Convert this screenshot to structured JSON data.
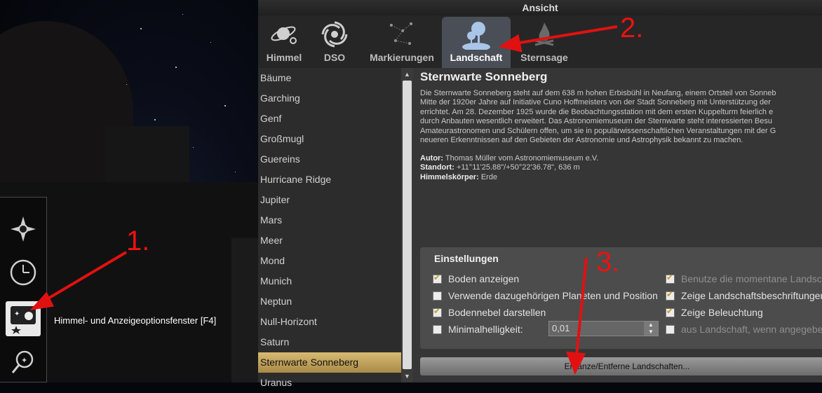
{
  "window_title": "Ansicht",
  "tabs": [
    {
      "label": "Himmel",
      "icon": "planet-icon"
    },
    {
      "label": "DSO",
      "icon": "galaxy-icon"
    },
    {
      "label": "Markierungen",
      "icon": "constellation-icon"
    },
    {
      "label": "Landschaft",
      "icon": "landscape-tree-icon"
    },
    {
      "label": "Sternsage",
      "icon": "campfire-icon"
    }
  ],
  "active_tab": "Landschaft",
  "landscapes": [
    "Bäume",
    "Garching",
    "Genf",
    "Großmugl",
    "Guereins",
    "Hurricane Ridge",
    "Jupiter",
    "Mars",
    "Meer",
    "Mond",
    "Munich",
    "Neptun",
    "Null-Horizont",
    "Saturn",
    "Sternwarte Sonneberg",
    "Uranus"
  ],
  "selected_landscape": "Sternwarte Sonneberg",
  "description": {
    "title": "Sternwarte Sonneberg",
    "body_lines": [
      "Die Sternwarte Sonneberg steht auf dem 638 m hohen Erbisbühl in Neufang, einem Ortsteil von Sonneb",
      "Mitte der 1920er Jahre auf Initiative Cuno Hoffmeisters von der Stadt Sonneberg mit Unterstützung der",
      "errichtet. Am 28. Dezember 1925 wurde die Beobachtungsstation mit dem ersten Kuppelturm feierlich e",
      "durch Anbauten wesentlich erweitert. Das Astronomiemuseum der Sternwarte steht interessierten Besu",
      "Amateurastronomen und Schülern offen, um sie in populärwissenschaftlichen Veranstaltungen mit der G",
      "neueren Erkenntnissen auf den Gebieten der Astronomie und Astrophysik bekannt zu machen."
    ],
    "author_label": "Autor:",
    "author": "Thomas Müller vom Astronomiemuseum e.V.",
    "location_label": "Standort:",
    "location": "+11°11'25.88\"/+50°22'36.78\", 636 m",
    "body_label": "Himmelskörper:",
    "body": "Erde"
  },
  "settings": {
    "title": "Einstellungen",
    "checkboxes": [
      {
        "label": "Boden anzeigen",
        "checked": true,
        "enabled": true
      },
      {
        "label": "Verwende dazugehörigen Planeten und Position",
        "checked": false,
        "enabled": true
      },
      {
        "label": "Bodennebel darstellen",
        "checked": true,
        "enabled": true
      },
      {
        "label": "Minimalhelligkeit:",
        "checked": false,
        "enabled": true
      },
      {
        "label": "Benutze die momentane Landsch",
        "checked": true,
        "enabled": false
      },
      {
        "label": "Zeige Landschaftsbeschriftungen",
        "checked": true,
        "enabled": true
      },
      {
        "label": "Zeige Beleuchtung",
        "checked": true,
        "enabled": true
      },
      {
        "label": "aus Landschaft, wenn angegebe",
        "checked": false,
        "enabled": false
      }
    ],
    "min_brightness_value": "0,01"
  },
  "add_remove_button": "Ergänze/Entferne Landschaften...",
  "sidebar": {
    "tooltip": "Himmel- und Anzeigeoptionsfenster  [F4]",
    "buttons": [
      {
        "name": "location-button",
        "icon": "compass-star-icon"
      },
      {
        "name": "time-button",
        "icon": "clock-icon"
      },
      {
        "name": "sky-view-options-button",
        "icon": "sky-options-icon"
      },
      {
        "name": "search-button",
        "icon": "magnifier-icon"
      }
    ]
  },
  "annotations": [
    "1.",
    "2.",
    "3."
  ],
  "colors": {
    "accent": "#c69c2a",
    "selection": "#cdb06a",
    "annotation": "#e11111"
  }
}
